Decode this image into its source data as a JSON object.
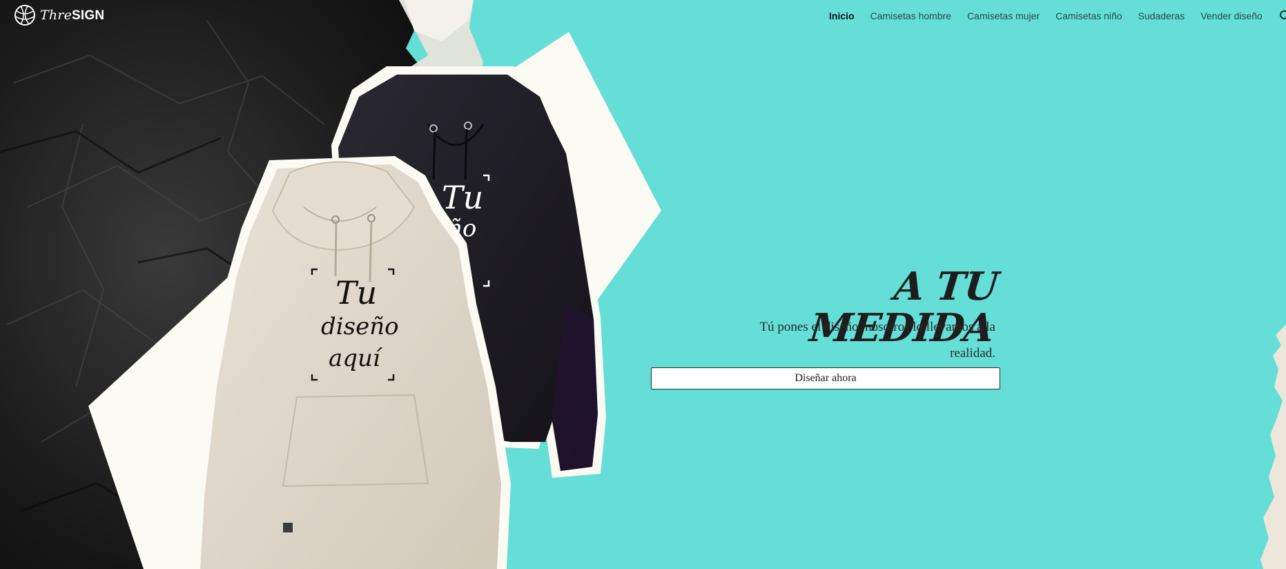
{
  "brand": {
    "thre": "Thre",
    "sign": "SIGN"
  },
  "nav": {
    "items": [
      {
        "label": "Inicio",
        "active": true
      },
      {
        "label": "Camisetas hombre"
      },
      {
        "label": "Camisetas mujer"
      },
      {
        "label": "Camisetas niño"
      },
      {
        "label": "Sudaderas"
      },
      {
        "label": "Vender diseño"
      }
    ],
    "search_icon": "search-icon"
  },
  "hero": {
    "headline": "A TU MEDIDA",
    "tagline": "Tú pones el diseño, nosotros lo llevamos a la realidad.",
    "cta": "Diseñar ahora",
    "hoodie_print": [
      "Tu",
      "diseño",
      "aquí"
    ]
  },
  "colors": {
    "background": "#64ded6",
    "dark_texture": "#1b1b1b",
    "paper": "#fbfaf3",
    "hoodie_light": "#ddd6c9",
    "hoodie_dark": "#1e1c22"
  }
}
